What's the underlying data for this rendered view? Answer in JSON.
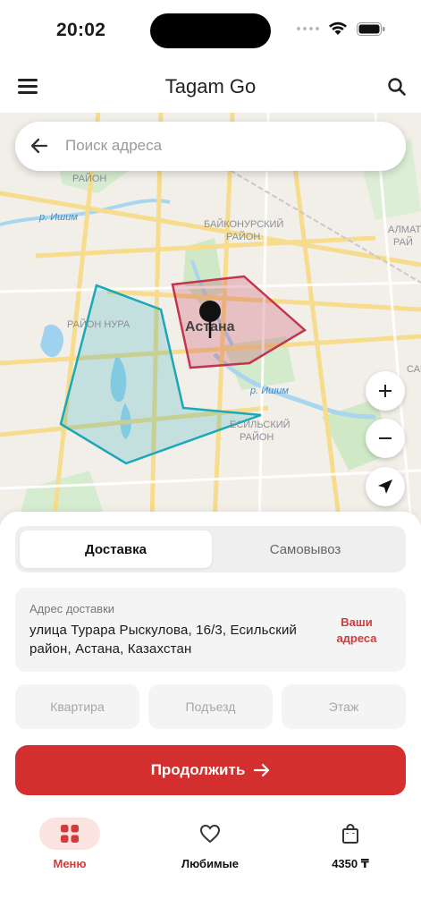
{
  "status_bar": {
    "time": "20:02"
  },
  "header": {
    "title": "Tagam Go",
    "menu_icon": "hamburger-menu-icon",
    "search_icon": "search-icon"
  },
  "map": {
    "search_placeholder": "Поиск адреса",
    "labels": {
      "district_1": "РАЙОН",
      "river_1": "р. Ишим",
      "baikonur": "БАЙКОНУРСКИЙ",
      "baikonur_rayon": "РАЙОН",
      "almaty": "АЛМАТ",
      "almaty_rayon": "РАЙ",
      "nura": "РАЙОН НУРА",
      "city": "Астана",
      "river_2": "р. Ишим",
      "yesil": "ЕСИЛЬСКИЙ",
      "yesil_rayon": "РАЙОН",
      "sary": "САР"
    },
    "zone_colors": {
      "red_zone": "#c2354f",
      "teal_zone": "#1aa8b8"
    }
  },
  "sheet": {
    "tabs": {
      "delivery": "Доставка",
      "pickup": "Самовывоз"
    },
    "address": {
      "label": "Адрес доставки",
      "value": "улица Турара Рыскулова, 16/3, Есильский район, Астана, Казахстан",
      "your_addresses": "Ваши адреса"
    },
    "fields": {
      "apartment": "Квартира",
      "entrance": "Подъезд",
      "floor": "Этаж"
    },
    "continue_label": "Продолжить",
    "accent": "#d32f2f"
  },
  "tabbar": {
    "menu": "Меню",
    "favorites": "Любимые",
    "cart": "4350 ₸"
  }
}
